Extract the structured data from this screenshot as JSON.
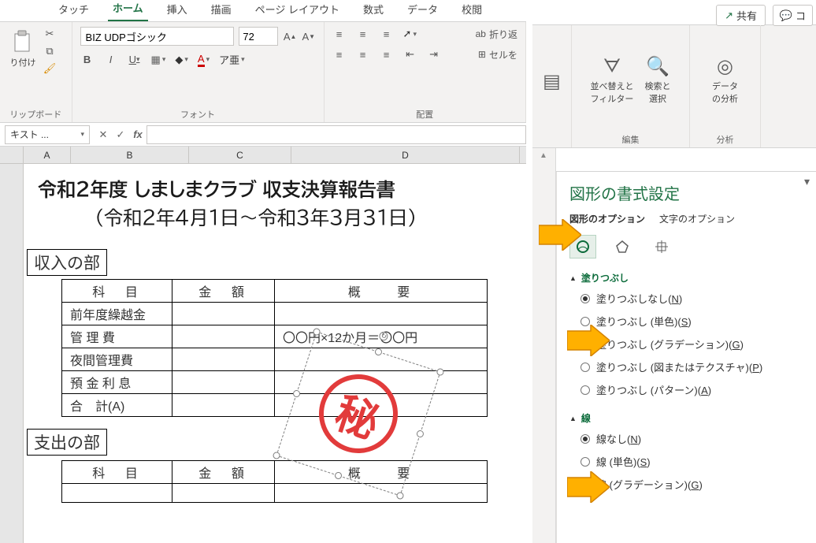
{
  "ribbon": {
    "tabs": [
      "タッチ",
      "ホーム",
      "挿入",
      "描画",
      "ページ レイアウト",
      "数式",
      "データ",
      "校閲"
    ],
    "active_tab": "ホーム",
    "clipboard_label": "リップボード",
    "paste_label": "り付け",
    "font_label": "フォント",
    "align_label": "配置",
    "font_name": "BIZ UDPゴシック",
    "font_size": "72",
    "wrap_text": "折り返",
    "merge": "セルを"
  },
  "formula_bar": {
    "name_box": "キスト ..."
  },
  "columns": [
    "A",
    "B",
    "C",
    "D"
  ],
  "doc": {
    "title_line1": "令和２年度  しましまクラブ  収支決算報告書",
    "title_line2": "（令和2年4月1日～令和3年3月31日）",
    "section_income": "収入の部",
    "section_expense": "支出の部",
    "headers": {
      "subject": "科　目",
      "amount": "金　額",
      "desc": "概　　要"
    },
    "income_rows": [
      {
        "subject": "前年度繰越金",
        "amount": "",
        "desc": ""
      },
      {
        "subject": "管 理 費",
        "amount": "",
        "desc": "〇〇円×12か月＝〇〇円"
      },
      {
        "subject": "夜間管理費",
        "amount": "",
        "desc": ""
      },
      {
        "subject": "預 金 利 息",
        "amount": "",
        "desc": ""
      },
      {
        "subject": "合　計(A)",
        "amount": "",
        "desc": ""
      }
    ],
    "stamp_text": "秘"
  },
  "right": {
    "share": "共有",
    "comment": "コ",
    "edit_group": "編集",
    "analysis_group": "分析",
    "sort_filter": "並べ替えと\nフィルター",
    "find_select": "検索と\n選択",
    "data_analysis": "データ\nの分析"
  },
  "task_pane": {
    "title": "図形の書式設定",
    "tab_shape": "図形のオプション",
    "tab_text": "文字のオプション",
    "fill_head": "塗りつぶし",
    "fill_options": [
      {
        "label": "塗りつぶしなし",
        "accel": "N",
        "checked": true
      },
      {
        "label": "塗りつぶし (単色)",
        "accel": "S",
        "checked": false
      },
      {
        "label": "塗りつぶし (グラデーション)",
        "accel": "G",
        "checked": false
      },
      {
        "label": "塗りつぶし (図またはテクスチャ)",
        "accel": "P",
        "checked": false
      },
      {
        "label": "塗りつぶし (パターン)",
        "accel": "A",
        "checked": false
      }
    ],
    "line_head": "線",
    "line_options": [
      {
        "label": "線なし",
        "accel": "N",
        "checked": true
      },
      {
        "label": "線 (単色)",
        "accel": "S",
        "checked": false
      },
      {
        "label": "線 (グラデーション)",
        "accel": "G",
        "checked": false
      }
    ]
  }
}
